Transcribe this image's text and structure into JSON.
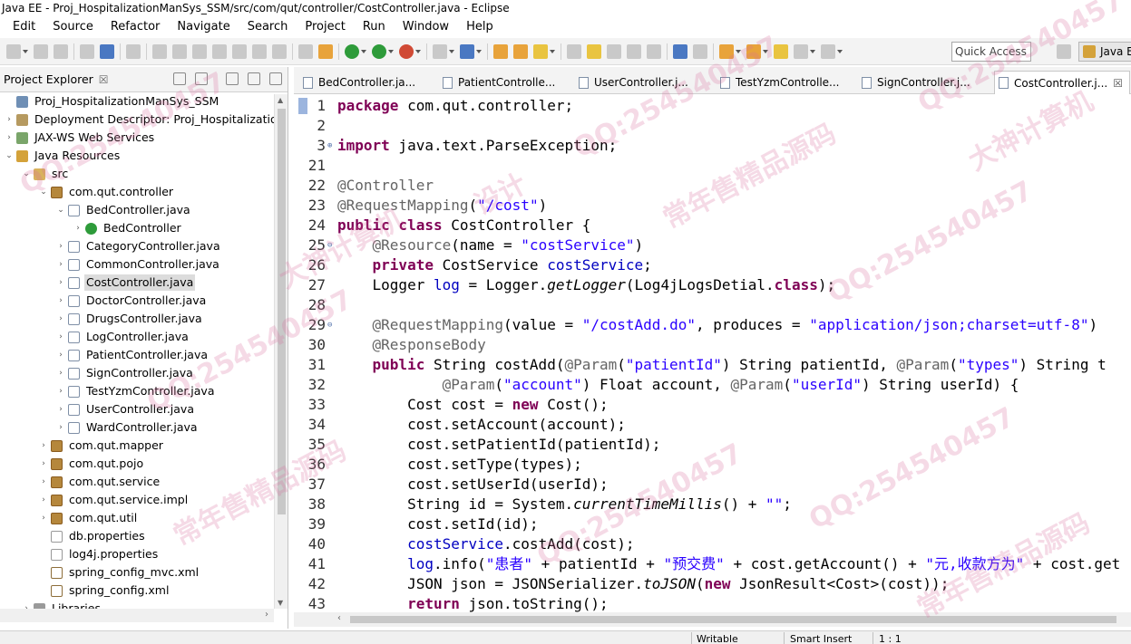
{
  "window": {
    "title": "Java EE - Proj_HospitalizationManSys_SSM/src/com/qut/controller/CostController.java - Eclipse"
  },
  "menu": [
    "Edit",
    "Source",
    "Refactor",
    "Navigate",
    "Search",
    "Project",
    "Run",
    "Window",
    "Help"
  ],
  "toolbar": {
    "quick_access": "Quick Access",
    "perspective": "Java E"
  },
  "explorer": {
    "title": "Project Explorer",
    "close": "☒",
    "tree": [
      {
        "label": "Proj_HospitalizationManSys_SSM",
        "icon": "project-icon",
        "level": 0,
        "arrow": ""
      },
      {
        "label": "Deployment Descriptor: Proj_Hospitalization",
        "icon": "deployment-descriptor-icon",
        "level": 0,
        "arrow": "›"
      },
      {
        "label": "JAX-WS Web Services",
        "icon": "web-services-icon",
        "level": 0,
        "arrow": "›"
      },
      {
        "label": "Java Resources",
        "icon": "java-resources-icon",
        "level": 0,
        "arrow": "⌄"
      },
      {
        "label": "src",
        "icon": "source-folder-icon",
        "level": 1,
        "arrow": "⌄"
      },
      {
        "label": "com.qut.controller",
        "icon": "package-icon",
        "level": 2,
        "arrow": "⌄"
      },
      {
        "label": "BedController.java",
        "icon": "java-file-icon",
        "level": 3,
        "arrow": "⌄"
      },
      {
        "label": "BedController",
        "icon": "class-icon",
        "level": 4,
        "arrow": "›"
      },
      {
        "label": "CategoryController.java",
        "icon": "java-file-icon",
        "level": 3,
        "arrow": "›"
      },
      {
        "label": "CommonController.java",
        "icon": "java-file-icon",
        "level": 3,
        "arrow": "›"
      },
      {
        "label": "CostController.java",
        "icon": "java-file-icon",
        "level": 3,
        "arrow": "›",
        "selected": true
      },
      {
        "label": "DoctorController.java",
        "icon": "java-file-icon",
        "level": 3,
        "arrow": "›"
      },
      {
        "label": "DrugsController.java",
        "icon": "java-file-icon",
        "level": 3,
        "arrow": "›"
      },
      {
        "label": "LogController.java",
        "icon": "java-file-icon",
        "level": 3,
        "arrow": "›"
      },
      {
        "label": "PatientController.java",
        "icon": "java-file-icon",
        "level": 3,
        "arrow": "›"
      },
      {
        "label": "SignController.java",
        "icon": "java-file-icon",
        "level": 3,
        "arrow": "›"
      },
      {
        "label": "TestYzmController.java",
        "icon": "java-file-icon",
        "level": 3,
        "arrow": "›"
      },
      {
        "label": "UserController.java",
        "icon": "java-file-icon",
        "level": 3,
        "arrow": "›"
      },
      {
        "label": "WardController.java",
        "icon": "java-file-icon",
        "level": 3,
        "arrow": "›"
      },
      {
        "label": "com.qut.mapper",
        "icon": "package-icon",
        "level": 2,
        "arrow": "›"
      },
      {
        "label": "com.qut.pojo",
        "icon": "package-icon",
        "level": 2,
        "arrow": "›"
      },
      {
        "label": "com.qut.service",
        "icon": "package-icon",
        "level": 2,
        "arrow": "›"
      },
      {
        "label": "com.qut.service.impl",
        "icon": "package-icon",
        "level": 2,
        "arrow": "›"
      },
      {
        "label": "com.qut.util",
        "icon": "package-icon",
        "level": 2,
        "arrow": "›"
      },
      {
        "label": "db.properties",
        "icon": "properties-file-icon",
        "level": 2,
        "arrow": ""
      },
      {
        "label": "log4j.properties",
        "icon": "properties-file-icon",
        "level": 2,
        "arrow": ""
      },
      {
        "label": "spring_config_mvc.xml",
        "icon": "xml-file-icon",
        "level": 2,
        "arrow": ""
      },
      {
        "label": "spring_config.xml",
        "icon": "xml-file-icon",
        "level": 2,
        "arrow": ""
      },
      {
        "label": "Libraries",
        "icon": "libraries-icon",
        "level": 1,
        "arrow": "›"
      }
    ]
  },
  "editor": {
    "tabs": [
      {
        "label": "BedController.ja...",
        "active": false
      },
      {
        "label": "PatientControlle...",
        "active": false
      },
      {
        "label": "UserController.j...",
        "active": false
      },
      {
        "label": "TestYzmControlle...",
        "active": false
      },
      {
        "label": "SignController.j...",
        "active": false
      },
      {
        "label": "CostController.j...",
        "active": true
      }
    ],
    "lines": [
      {
        "n": "1",
        "html": "<span class=\"kw\">package</span> com.qut.controller;"
      },
      {
        "n": "2",
        "html": ""
      },
      {
        "n": "3",
        "fold": "⊕",
        "html": "<span class=\"kw\">import</span> java.text.ParseException;"
      },
      {
        "n": "21",
        "html": ""
      },
      {
        "n": "22",
        "html": "<span class=\"ann\">@Controller</span>"
      },
      {
        "n": "23",
        "html": "<span class=\"ann\">@RequestMapping</span>(<span class=\"str\">\"/cost\"</span>)"
      },
      {
        "n": "24",
        "html": "<span class=\"kw\">public class</span> CostController {"
      },
      {
        "n": "25",
        "fold": "⊖",
        "html": "    <span class=\"ann\">@Resource</span>(name = <span class=\"str\">\"costService\"</span>)"
      },
      {
        "n": "26",
        "html": "    <span class=\"kw\">private</span> CostService <span class=\"fld\">costService</span>;"
      },
      {
        "n": "27",
        "html": "    Logger <span class=\"fld\">log</span> = Logger.<span class=\"it\">getLogger</span>(Log4jLogsDetial.<span class=\"kw\">class</span>);"
      },
      {
        "n": "28",
        "html": ""
      },
      {
        "n": "29",
        "fold": "⊖",
        "html": "    <span class=\"ann\">@RequestMapping</span>(value = <span class=\"str\">\"/costAdd.do\"</span>, produces = <span class=\"str\">\"application/json;charset=utf-8\"</span>)"
      },
      {
        "n": "30",
        "html": "    <span class=\"ann\">@ResponseBody</span>"
      },
      {
        "n": "31",
        "html": "    <span class=\"kw\">public</span> String costAdd(<span class=\"ann\">@Param</span>(<span class=\"str\">\"patientId\"</span>) String patientId, <span class=\"ann\">@Param</span>(<span class=\"str\">\"types\"</span>) String t"
      },
      {
        "n": "32",
        "html": "            <span class=\"ann\">@Param</span>(<span class=\"str\">\"account\"</span>) Float account, <span class=\"ann\">@Param</span>(<span class=\"str\">\"userId\"</span>) String userId) {"
      },
      {
        "n": "33",
        "html": "        Cost cost = <span class=\"kw\">new</span> Cost();"
      },
      {
        "n": "34",
        "html": "        cost.setAccount(account);"
      },
      {
        "n": "35",
        "html": "        cost.setPatientId(patientId);"
      },
      {
        "n": "36",
        "html": "        cost.setType(types);"
      },
      {
        "n": "37",
        "html": "        cost.setUserId(userId);"
      },
      {
        "n": "38",
        "html": "        String id = System.<span class=\"it\">currentTimeMillis</span>() + <span class=\"str\">\"\"</span>;"
      },
      {
        "n": "39",
        "html": "        cost.setId(id);"
      },
      {
        "n": "40",
        "html": "        <span class=\"fld\">costService</span>.costAdd(cost);"
      },
      {
        "n": "41",
        "html": "        <span class=\"fld\">log</span>.info(<span class=\"str\">\"患者\"</span> + patientId + <span class=\"str\">\"预交费\"</span> + cost.getAccount() + <span class=\"str\">\"元,收款方为\"</span> + cost.get"
      },
      {
        "n": "42",
        "html": "        JSON json = JSONSerializer.<span class=\"it\">toJSON</span>(<span class=\"kw\">new</span> JsonResult&lt;Cost&gt;(cost));"
      },
      {
        "n": "43",
        "html": "        <span class=\"kw\">return</span> json.toString();"
      }
    ]
  },
  "status": {
    "writable": "Writable",
    "insert_mode": "Smart Insert",
    "position": "1 : 1"
  },
  "watermarks": [
    "QQ:254540457",
    "大神计算机",
    "常年售精品源码",
    "设计"
  ]
}
